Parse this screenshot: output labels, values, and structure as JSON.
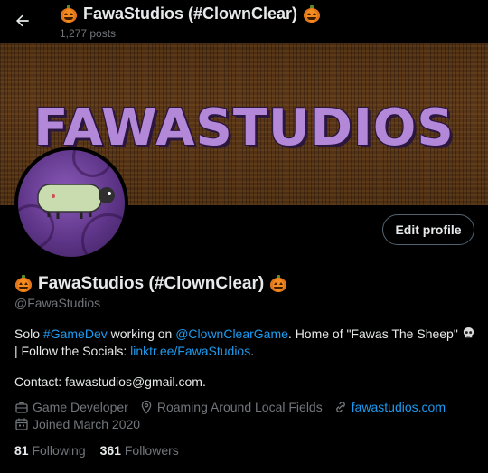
{
  "header": {
    "title": "FawaStudios (#ClownClear)",
    "post_count": "1,277 posts"
  },
  "banner": {
    "text": "FAWASTUDIOS"
  },
  "profile": {
    "edit_label": "Edit profile",
    "name": "FawaStudios (#ClownClear)",
    "handle": "@FawaStudios",
    "bio": {
      "part1": "Solo ",
      "hashtag": "#GameDev",
      "part2": " working on ",
      "mention": "@ClownClearGame",
      "part3": ". Home of \"Fawas The Sheep\" ",
      "part4": " | Follow the Socials: ",
      "socials_link": "linktr.ee/FawaStudios",
      "part5": "."
    },
    "contact": "Contact: fawastudios@gmail.com.",
    "category": "Game Developer",
    "location": "Roaming Around Local Fields",
    "website": "fawastudios.com",
    "joined": "Joined March 2020",
    "following_count": "81",
    "following_label": "Following",
    "followers_count": "361",
    "followers_label": "Followers"
  },
  "icons": {
    "back": "arrow-left-icon",
    "pumpkin": "jack-o-lantern-icon",
    "skull": "skull-icon",
    "category": "briefcase-icon",
    "location": "location-pin-icon",
    "website": "link-icon",
    "joined": "calendar-icon"
  },
  "colors": {
    "background": "#000000",
    "text": "#e7e9ea",
    "muted": "#71767b",
    "link": "#1d9bf0",
    "banner_text": "#b388d9",
    "avatar_bg": "#6a3f95"
  }
}
